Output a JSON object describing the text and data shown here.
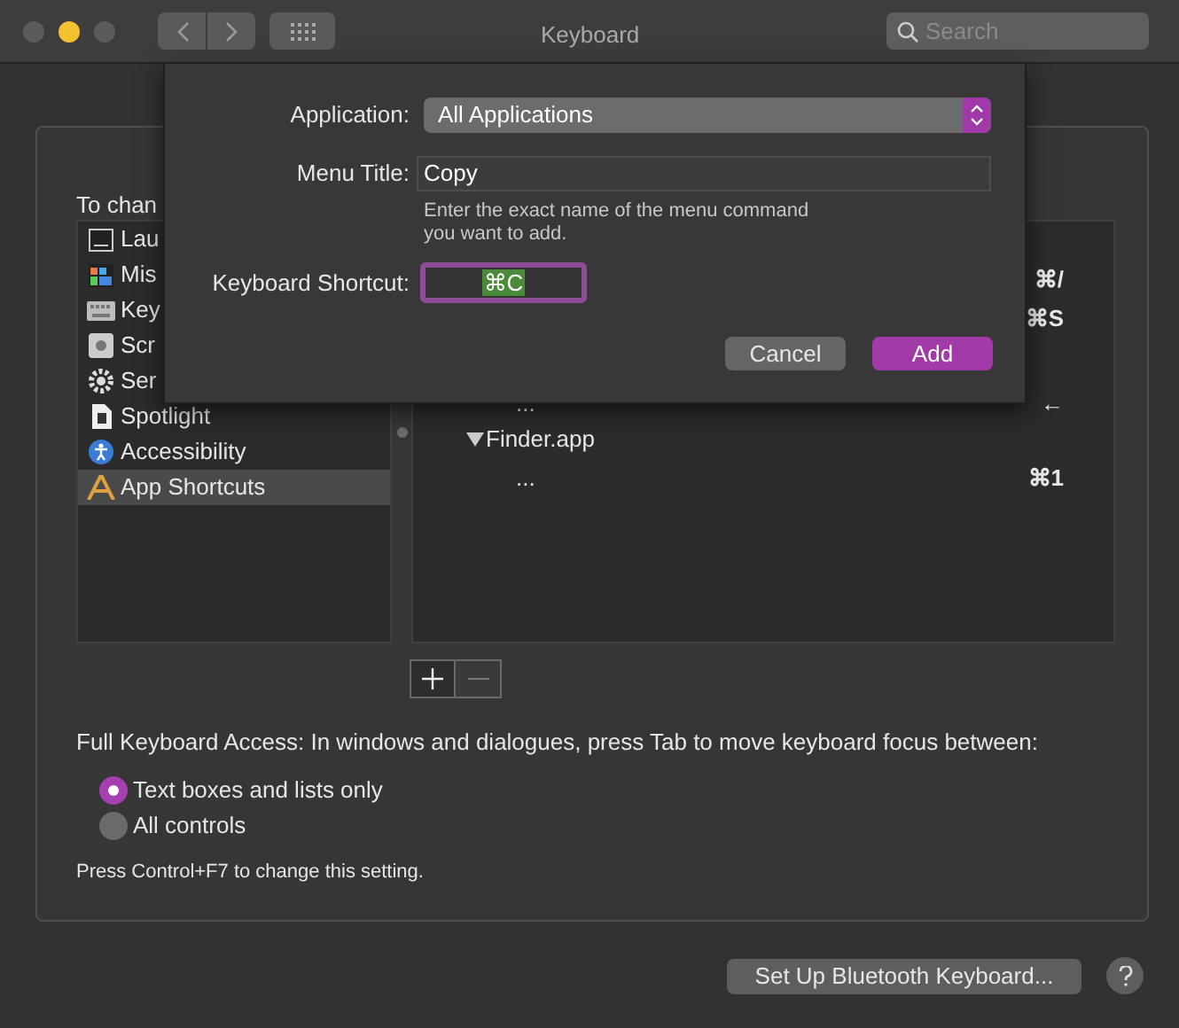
{
  "window": {
    "title": "Keyboard",
    "search": {
      "placeholder": "Search"
    }
  },
  "panel": {
    "intro": "To chan",
    "sidebar": [
      {
        "label": "Lau",
        "selected": false
      },
      {
        "label": "Mis",
        "selected": false
      },
      {
        "label": "Key",
        "selected": false
      },
      {
        "label": "Scr",
        "selected": false
      },
      {
        "label": "Ser",
        "selected": false
      },
      {
        "label": "Spotlight",
        "selected": false
      },
      {
        "label": "Accessibility",
        "selected": false
      },
      {
        "label": "App Shortcuts",
        "selected": true
      }
    ],
    "shortcuts": [
      {
        "kind": "shortcut",
        "shortcut": "⌘/"
      },
      {
        "kind": "shortcut",
        "shortcut": "⌘S"
      },
      {
        "kind": "shortcut",
        "label": "...",
        "shortcut": "←"
      },
      {
        "kind": "app",
        "label": "Finder.app",
        "expanded": true
      },
      {
        "kind": "shortcut",
        "label": "...",
        "shortcut": "⌘1"
      }
    ],
    "full_keyboard_access": "Full Keyboard Access: In windows and dialogues, press Tab to move keyboard focus between:",
    "options": [
      {
        "label": "Text boxes and lists only",
        "selected": true
      },
      {
        "label": "All controls",
        "selected": false
      }
    ],
    "hint": "Press Control+F7 to change this setting."
  },
  "bluetooth_button": "Set Up Bluetooth Keyboard...",
  "sheet": {
    "application_label": "Application:",
    "application": "All Applications",
    "menu_title_label": "Menu Title:",
    "menu_title": "Copy",
    "menu_hint": "Enter the exact name of the menu command\nyou want to add.",
    "shortcut_label": "Keyboard Shortcut:",
    "shortcut": "⌘C",
    "buttons": [
      {
        "label": "Cancel",
        "default": false
      },
      {
        "label": "Add",
        "default": true
      }
    ]
  }
}
